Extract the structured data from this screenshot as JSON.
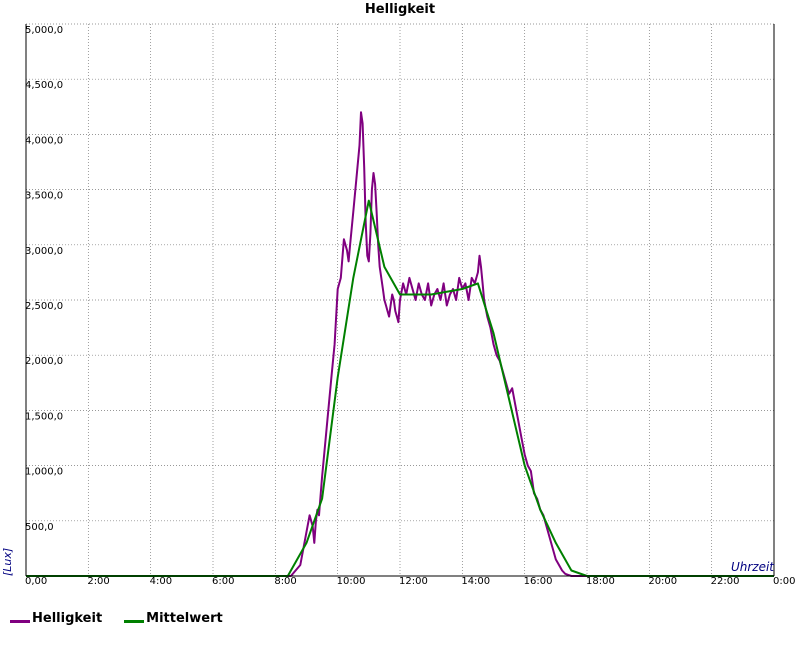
{
  "chart_data": {
    "type": "line",
    "title": "Helligkeit",
    "xlabel": "Uhrzeit",
    "ylabel": "[Lux]",
    "xlim": [
      0,
      24
    ],
    "ylim": [
      0,
      5000
    ],
    "x_ticks": [
      0,
      2,
      4,
      6,
      8,
      10,
      12,
      14,
      16,
      18,
      20,
      22,
      24
    ],
    "x_tick_labels": [
      "0,00",
      "2:00",
      "4:00",
      "6:00",
      "8:00",
      "10:00",
      "12:00",
      "14:00",
      "16:00",
      "18:00",
      "20:00",
      "22:00",
      "0:00"
    ],
    "y_ticks": [
      500,
      1000,
      1500,
      2000,
      2500,
      3000,
      3500,
      4000,
      4500,
      5000
    ],
    "y_tick_labels": [
      "500,0",
      "1,000,0",
      "1,500,0",
      "2,000,0",
      "2,500,0",
      "3,000,0",
      "3,500,0",
      "4,000,0",
      "4,500,0",
      "5,000,0"
    ],
    "grid": true,
    "legend_position": "bottom-left",
    "series": [
      {
        "name": "Helligkeit",
        "color": "#800080",
        "x": [
          0,
          8.5,
          8.8,
          8.9,
          9.0,
          9.1,
          9.2,
          9.25,
          9.3,
          9.35,
          9.4,
          9.5,
          9.6,
          9.7,
          9.8,
          9.9,
          10.0,
          10.1,
          10.2,
          10.3,
          10.35,
          10.4,
          10.5,
          10.6,
          10.7,
          10.75,
          10.8,
          10.85,
          10.9,
          10.95,
          11.0,
          11.05,
          11.1,
          11.15,
          11.2,
          11.25,
          11.3,
          11.35,
          11.4,
          11.45,
          11.5,
          11.55,
          11.6,
          11.65,
          11.7,
          11.75,
          11.8,
          11.85,
          11.9,
          11.95,
          12.0,
          12.1,
          12.2,
          12.3,
          12.4,
          12.5,
          12.6,
          12.7,
          12.8,
          12.9,
          13.0,
          13.1,
          13.2,
          13.3,
          13.4,
          13.5,
          13.6,
          13.7,
          13.8,
          13.9,
          14.0,
          14.1,
          14.2,
          14.3,
          14.4,
          14.5,
          14.55,
          14.6,
          14.65,
          14.7,
          14.8,
          14.9,
          15.0,
          15.1,
          15.2,
          15.3,
          15.4,
          15.5,
          15.6,
          15.7,
          15.8,
          15.9,
          16.0,
          16.1,
          16.2,
          16.3,
          16.4,
          16.5,
          16.6,
          16.7,
          16.8,
          16.9,
          17.0,
          17.1,
          17.2,
          17.3,
          17.4,
          17.5,
          17.7,
          17.9,
          18.0,
          24
        ],
        "y": [
          0,
          0,
          100,
          250,
          400,
          550,
          450,
          300,
          500,
          600,
          550,
          900,
          1200,
          1500,
          1800,
          2100,
          2600,
          2700,
          3050,
          2950,
          2850,
          3000,
          3300,
          3600,
          3900,
          4200,
          4100,
          3700,
          3200,
          2900,
          2850,
          3100,
          3500,
          3650,
          3550,
          3300,
          3000,
          2800,
          2700,
          2600,
          2500,
          2450,
          2400,
          2350,
          2450,
          2550,
          2500,
          2400,
          2350,
          2300,
          2500,
          2650,
          2550,
          2700,
          2600,
          2500,
          2650,
          2550,
          2500,
          2650,
          2450,
          2550,
          2600,
          2500,
          2650,
          2450,
          2550,
          2600,
          2500,
          2700,
          2600,
          2650,
          2500,
          2700,
          2650,
          2750,
          2900,
          2800,
          2650,
          2500,
          2350,
          2250,
          2100,
          2000,
          1950,
          1850,
          1750,
          1650,
          1700,
          1550,
          1400,
          1250,
          1100,
          1000,
          950,
          750,
          700,
          600,
          550,
          450,
          350,
          250,
          150,
          100,
          50,
          20,
          10,
          0,
          0,
          0,
          0,
          0
        ]
      },
      {
        "name": "Mittelwert",
        "color": "#008000",
        "x": [
          0,
          8.4,
          9.0,
          9.5,
          10.0,
          10.5,
          11.0,
          11.5,
          12.0,
          13.0,
          14.0,
          14.5,
          15.0,
          15.5,
          16.0,
          16.5,
          17.0,
          17.5,
          18.0,
          24
        ],
        "y": [
          0,
          0,
          300,
          700,
          1800,
          2700,
          3400,
          2800,
          2550,
          2550,
          2600,
          2650,
          2200,
          1600,
          1000,
          600,
          300,
          50,
          0,
          0
        ]
      }
    ]
  }
}
